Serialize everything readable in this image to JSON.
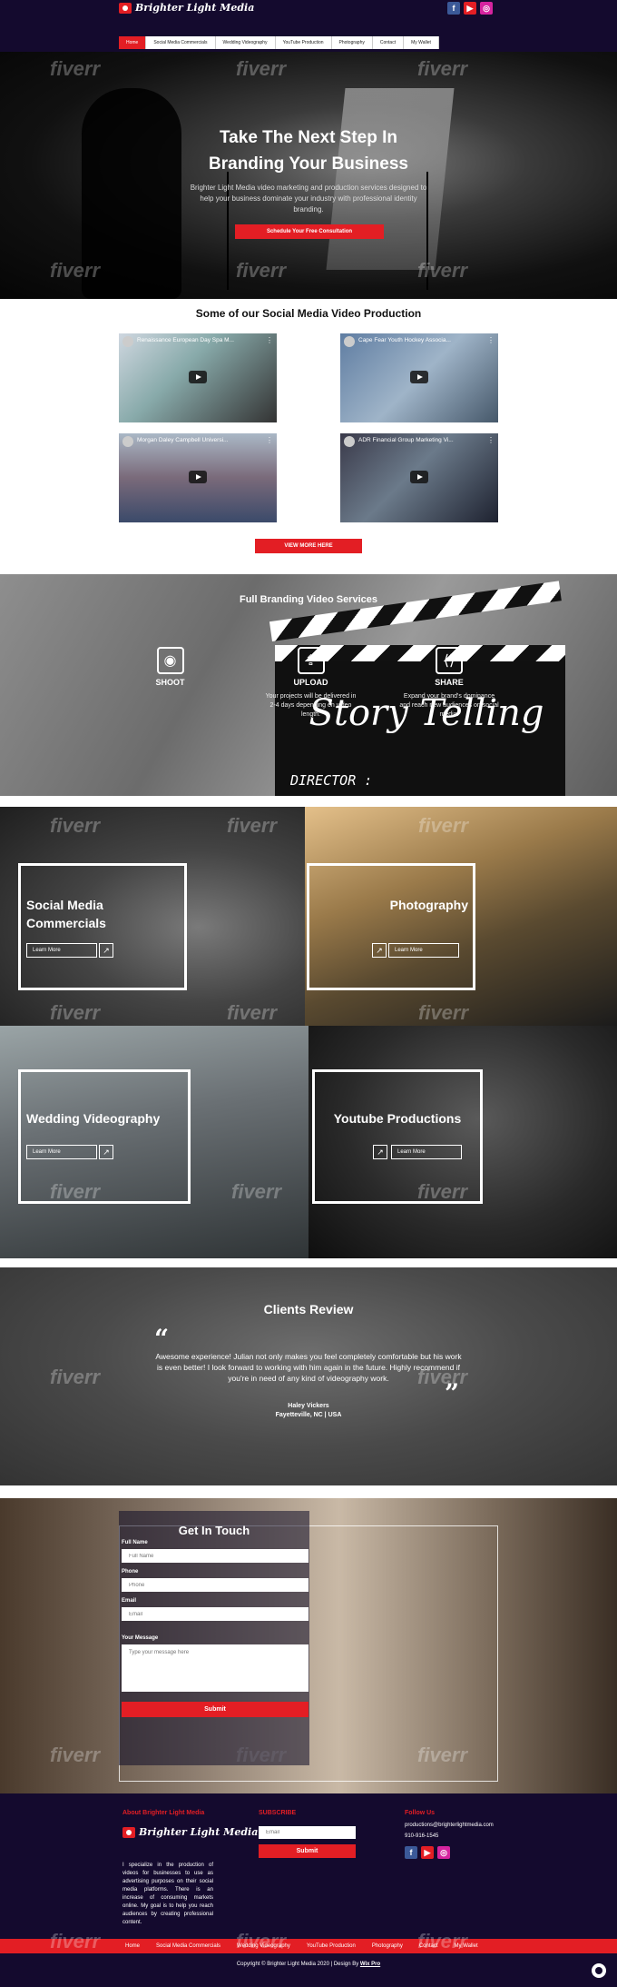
{
  "brand": {
    "name": "Brighter Light Media"
  },
  "nav": [
    "Home",
    "Social Media Commercials",
    "Wedding Videography",
    "YouTube Production",
    "Photography",
    "Contact",
    "My Wallet"
  ],
  "social": [
    "f",
    "▶",
    "◎"
  ],
  "watermark": "fiverr",
  "hero": {
    "title_line1": "Take The Next Step In",
    "title_line2": "Branding Your Business",
    "text": "Brighter Light Media video marketing and production services designed to help your business dominate your industry with professional identity branding.",
    "cta": "Schedule Your Free Consultation"
  },
  "videos": {
    "title": "Some of our Social Media Video Production",
    "items": [
      "Renaissance European Day Spa M...",
      "Cape Fear Youth Hockey Associa...",
      "Morgan Daley Campbell Universi...",
      "ADR Financial Group Marketing Vi..."
    ],
    "menu": "⋮",
    "view_more": "VIEW MORE HERE"
  },
  "services": {
    "title": "Full Branding Video Services",
    "items": [
      {
        "name": "SHOOT",
        "desc": ""
      },
      {
        "name": "UPLOAD",
        "desc": "Your projects will be delivered in 2-4 days depending on video length."
      },
      {
        "name": "SHARE",
        "desc": "Expand your brand's dominance and reach new audiences on social media."
      }
    ],
    "clapper_text": "Story Telling",
    "clapper_director": "DIRECTOR :"
  },
  "tiles": [
    {
      "title": "Social Media Commercials",
      "cta": "Learn More"
    },
    {
      "title": "Photography",
      "cta": "Learn More"
    },
    {
      "title": "Wedding Videography",
      "cta": "Learn More"
    },
    {
      "title": "Youtube Productions",
      "cta": "Learn More"
    }
  ],
  "review": {
    "title": "Clients Review",
    "text": "Awesome experience! Julian not only makes you feel completely comfortable but his work is even better! I look forward to working with him again in the future. Highly recommend if you're in need of any kind of videography work.",
    "name": "Haley Vickers",
    "location": "Fayetteville, NC | USA"
  },
  "contact": {
    "title": "Get In Touch",
    "full_name_label": "Full Name",
    "full_name_placeholder": "Full Name",
    "phone_label": "Phone",
    "phone_placeholder": "Phone",
    "email_label": "Email",
    "email_placeholder": "Email",
    "message_label": "Your Message",
    "message_placeholder": "Type your message here",
    "submit": "Submit"
  },
  "footer": {
    "about_heading": "About Brighter Light Media",
    "about_text": "I specialize in the production of videos for businesses to use as advertising purposes on their social media platforms. There is an increase of consuming markets online. My goal is to help you reach audiences by creating professional content.",
    "subscribe_heading": "SUBSCRIBE",
    "email_placeholder": "Email",
    "submit": "Submit",
    "follow_heading": "Follow Us",
    "email": "productions@brighterlightmedia.com",
    "phone": "910-916-1545",
    "nav": [
      "Home",
      "Social Media Commercials",
      "Wedding Videography",
      "YouTube Production",
      "Photography",
      "Contact",
      "My Wallet"
    ],
    "copyright": "Copyright © Brighter Light Media 2020 | Design By",
    "designer": "Wix Pro"
  },
  "colors": {
    "accent": "#e31e24",
    "dark": "#140a2e"
  }
}
